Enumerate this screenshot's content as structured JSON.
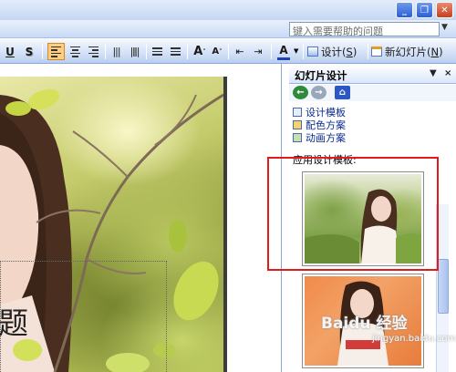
{
  "window": {
    "minimize_glyph": "_",
    "restore_glyph": "❐",
    "close_glyph": "✕"
  },
  "menubar": {
    "help_placeholder": "键入需要帮助的问题"
  },
  "toolbar": {
    "underline_glyph": "U",
    "shadow_glyph": "S",
    "font_grow": "A",
    "font_shrink": "A",
    "font_color": "A",
    "design_label": "设计",
    "design_key": "S",
    "new_slide_label": "新幻灯片",
    "new_slide_key": "N"
  },
  "slide": {
    "title_fragment": "题"
  },
  "task_pane": {
    "title": "幻灯片设计",
    "links": [
      "设计模板",
      "配色方案",
      "动画方案"
    ],
    "section_label": "应用设计模板:",
    "home_glyph": "⌂"
  },
  "watermark": {
    "text": "Baidu 经验",
    "sub": "jingyan.baidu.com"
  },
  "colors": {
    "highlight_box": "#e01b1b",
    "active_button": "#ffcc80"
  }
}
